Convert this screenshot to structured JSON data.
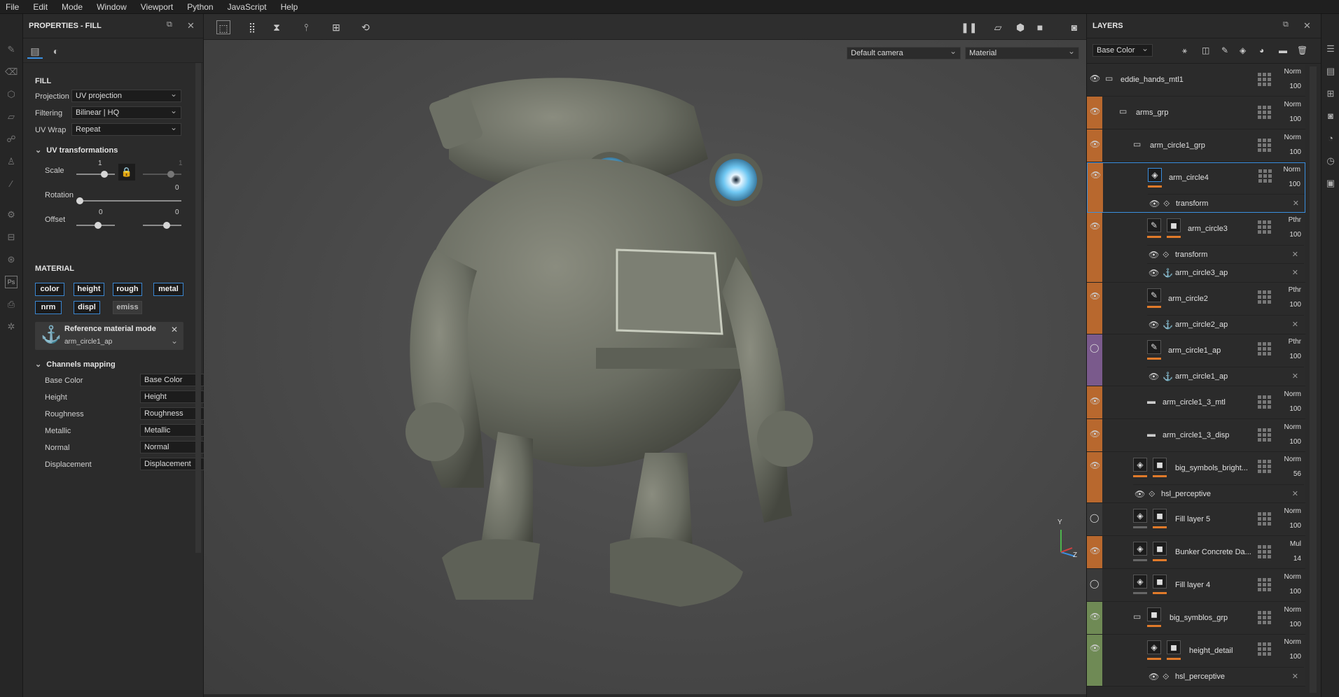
{
  "menu": [
    "File",
    "Edit",
    "Mode",
    "Window",
    "Viewport",
    "Python",
    "JavaScript",
    "Help"
  ],
  "properties": {
    "title": "PROPERTIES - FILL",
    "fill_section": "FILL",
    "projection_label": "Projection",
    "projection_value": "UV projection",
    "filtering_label": "Filtering",
    "filtering_value": "Bilinear | HQ",
    "uvwrap_label": "UV Wrap",
    "uvwrap_value": "Repeat",
    "uv_transformations": "UV transformations",
    "scale_label": "Scale",
    "scale_value": "1",
    "scale_value2": "1",
    "rotation_label": "Rotation",
    "rotation_value": "0",
    "offset_label": "Offset",
    "offset_value1": "0",
    "offset_value2": "0",
    "material_section": "MATERIAL",
    "channels": [
      "color",
      "height",
      "rough",
      "metal",
      "nrm",
      "displ",
      "emiss"
    ],
    "ref_title": "Reference material mode",
    "ref_value": "arm_circle1_ap",
    "channels_mapping": "Channels mapping",
    "mapping": [
      {
        "label": "Base Color",
        "value": "Base Color"
      },
      {
        "label": "Height",
        "value": "Height"
      },
      {
        "label": "Roughness",
        "value": "Roughness"
      },
      {
        "label": "Metallic",
        "value": "Metallic"
      },
      {
        "label": "Normal",
        "value": "Normal"
      },
      {
        "label": "Displacement",
        "value": "Displacement"
      }
    ]
  },
  "viewport": {
    "camera": "Default camera",
    "mode": "Material",
    "axis_y": "Y",
    "axis_z": "Z"
  },
  "layers": {
    "title": "LAYERS",
    "channel": "Base Color",
    "rows": [
      {
        "name": "eddie_hands_mtl1",
        "blend": "Norm",
        "opacity": "100"
      },
      {
        "name": "arms_grp",
        "blend": "Norm",
        "opacity": "100"
      },
      {
        "name": "arm_circle1_grp",
        "blend": "Norm",
        "opacity": "100"
      },
      {
        "name": "arm_circle4",
        "blend": "Norm",
        "opacity": "100",
        "sub": [
          "transform"
        ]
      },
      {
        "name": "arm_circle3",
        "blend": "Pthr",
        "opacity": "100",
        "sub": [
          "transform",
          "arm_circle3_ap"
        ]
      },
      {
        "name": "arm_circle2",
        "blend": "Pthr",
        "opacity": "100",
        "sub": [
          "arm_circle2_ap"
        ]
      },
      {
        "name": "arm_circle1_ap",
        "blend": "Pthr",
        "opacity": "100",
        "sub": [
          "arm_circle1_ap"
        ]
      },
      {
        "name": "arm_circle1_3_mtl",
        "blend": "Norm",
        "opacity": "100"
      },
      {
        "name": "arm_circle1_3_disp",
        "blend": "Norm",
        "opacity": "100"
      },
      {
        "name": "big_symbols_bright...",
        "blend": "Norm",
        "opacity": "56",
        "sub": [
          "hsl_perceptive"
        ]
      },
      {
        "name": "Fill layer 5",
        "blend": "Norm",
        "opacity": "100"
      },
      {
        "name": "Bunker Concrete Da...",
        "blend": "Mul",
        "opacity": "14"
      },
      {
        "name": "Fill layer 4",
        "blend": "Norm",
        "opacity": "100"
      },
      {
        "name": "big_symblos_grp",
        "blend": "Norm",
        "opacity": "100"
      },
      {
        "name": "height_detail",
        "blend": "Norm",
        "opacity": "100",
        "sub": [
          "hsl_perceptive"
        ]
      }
    ]
  },
  "colors": {
    "accent": "#3a8fe0",
    "orange": "#b8682e",
    "purple": "#7a5a8c",
    "green": "#6f8a55"
  }
}
